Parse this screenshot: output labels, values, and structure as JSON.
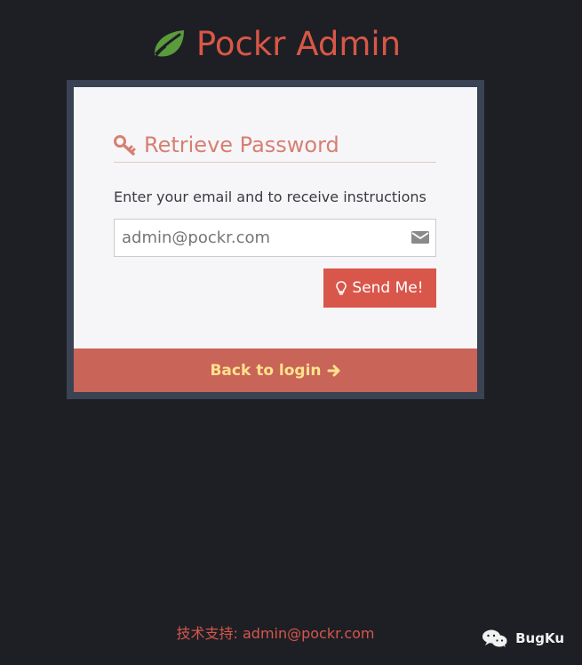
{
  "header": {
    "brand_title": "Pockr Admin",
    "brand_icon": "leaf-icon"
  },
  "panel": {
    "title": "Retrieve Password",
    "title_icon": "key-icon",
    "instruction": "Enter your email and to receive instructions",
    "email": {
      "value": "",
      "placeholder": "admin@pockr.com",
      "icon": "mail-icon"
    },
    "send_button": {
      "label": "Send Me!",
      "icon": "lightbulb-icon"
    },
    "back_link": {
      "label": "Back to login",
      "icon": "arrow-right-icon"
    }
  },
  "footer": {
    "support": "技术支持: admin@pockr.com"
  },
  "watermark": {
    "text": "BugKu",
    "icon": "wechat-icon"
  },
  "colors": {
    "background": "#1d1f24",
    "brand": "#d95746",
    "leaf": "#5a9c3c",
    "panel_title": "#d77f72",
    "button": "#d9564b",
    "back_bar": "#c96458",
    "back_text": "#ffe28d",
    "frame": "#3a4353"
  }
}
